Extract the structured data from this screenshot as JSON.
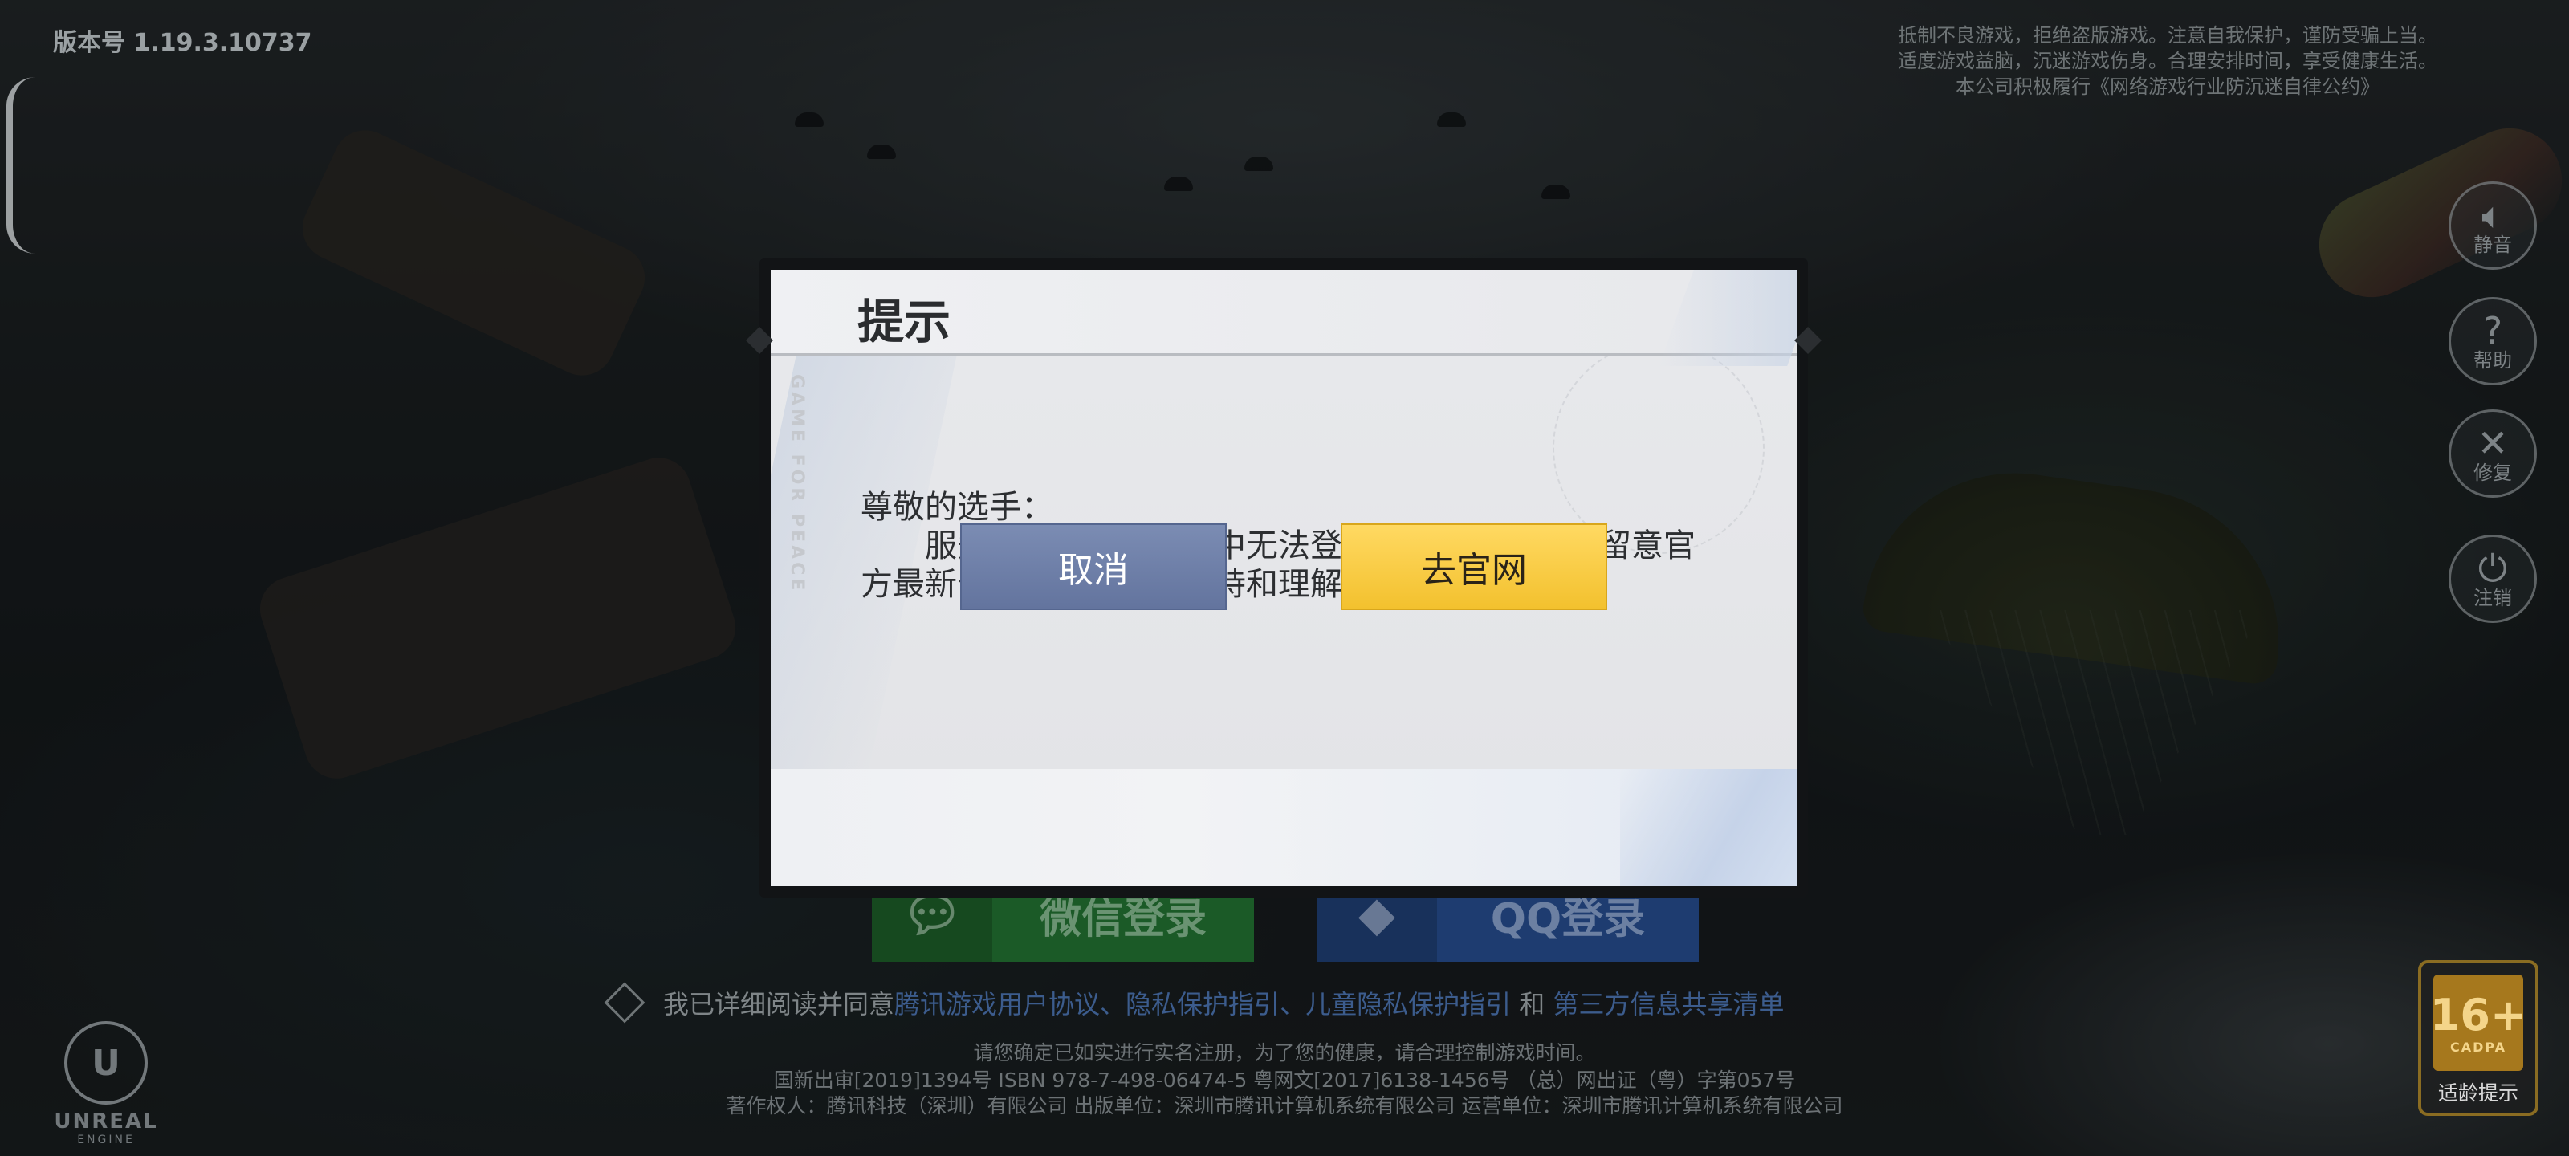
{
  "version_label": "版本号 1.19.3.10737",
  "top_notice": {
    "line1": "抵制不良游戏，拒绝盗版游戏。注意自我保护，谨防受骗上当。",
    "line2": "适度游戏益脑，沉迷游戏伤身。合理安排时间，享受健康生活。",
    "line3": "本公司积极履行《网络游戏行业防沉迷自律公约》"
  },
  "side_buttons": {
    "mute": {
      "icon": "speaker-icon",
      "label": "静音"
    },
    "help": {
      "icon": "help-icon",
      "label": "帮助"
    },
    "repair": {
      "icon": "wrench-icon",
      "label": "修复"
    },
    "logout": {
      "icon": "power-icon",
      "label": "注销"
    }
  },
  "login": {
    "wechat_label": "微信登录",
    "qq_label": "QQ登录"
  },
  "agreement": {
    "prefix": "我已详细阅读并同意",
    "link1": "腾讯游戏用户协议",
    "sep1": "、",
    "link2": "隐私保护指引",
    "sep2": "、",
    "link3": "儿童隐私保护指引",
    "and": " 和 ",
    "link4": "第三方信息共享清单"
  },
  "footer": {
    "line1": "请您确定已如实进行实名注册，为了您的健康，请合理控制游戏时间。",
    "line2": "国新出审[2019]1394号  ISBN 978-7-498-06474-5  粤网文[2017]6138-1456号 （总）网出证（粤）字第057号",
    "line3": "著作权人：腾讯科技（深圳）有限公司   出版单位：深圳市腾讯计算机系统有限公司   运营单位：深圳市腾讯计算机系统有限公司"
  },
  "engine_logo": {
    "title": "UNREAL",
    "subtitle": "ENGINE"
  },
  "age_rating": {
    "age": "16+",
    "org": "CADPA",
    "label": "适龄提示"
  },
  "dialog": {
    "title": "提示",
    "decor_text": "GAME FOR PEACE",
    "greeting": "尊敬的选手：",
    "message": "服务器暂时处于维护中无法登陆，开放时间敬请留意官方最新公告，感谢您的支持和理解。",
    "cancel_label": "取消",
    "website_label": "去官网"
  },
  "colors": {
    "cancel_button": "#6e7fa9",
    "website_button": "#f7c93b",
    "wechat": "#1b5a27",
    "qq": "#1e3c70"
  }
}
